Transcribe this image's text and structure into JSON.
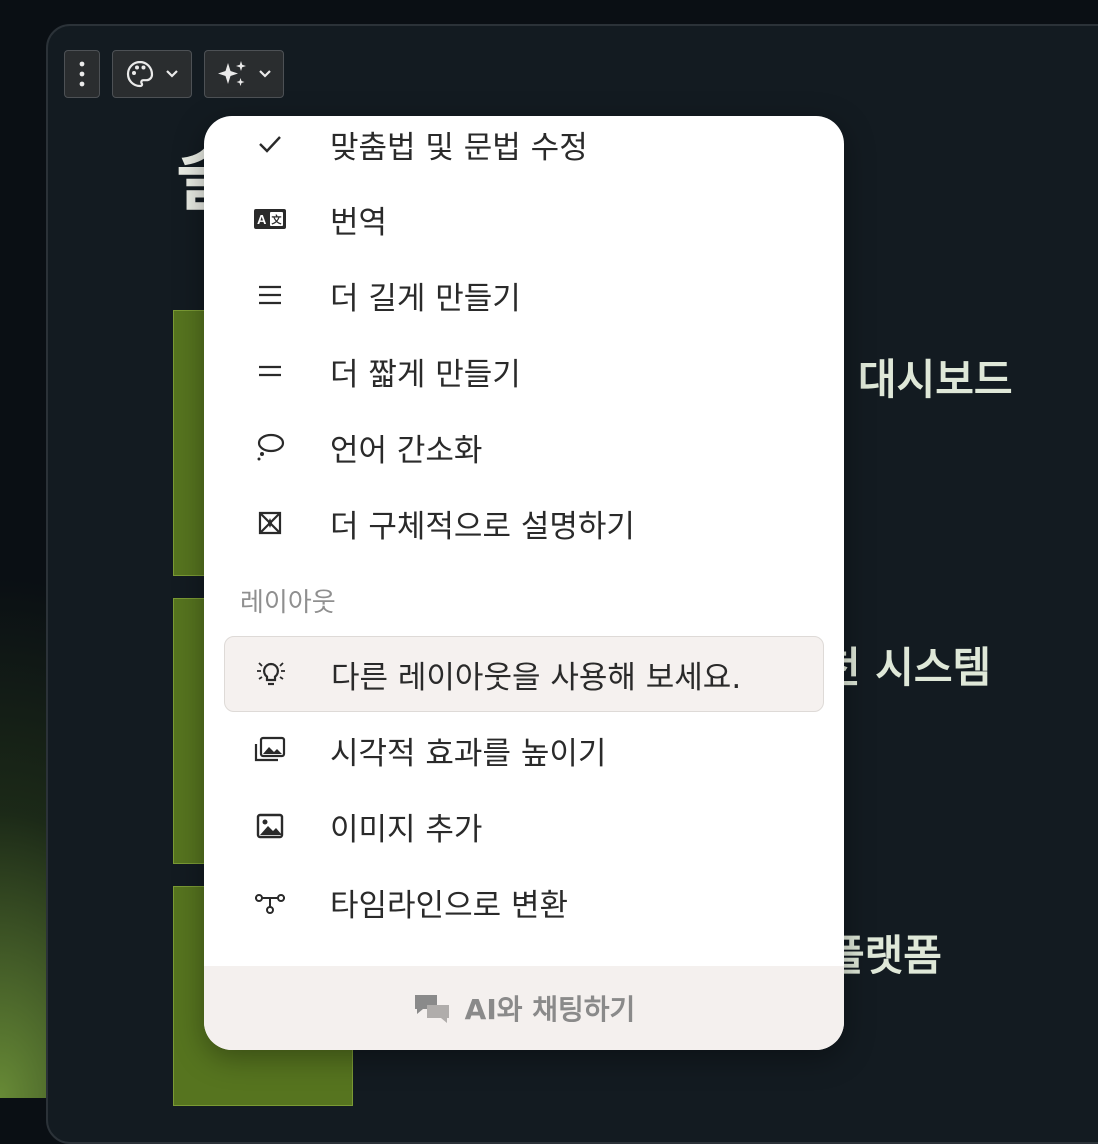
{
  "toolbar": {
    "more_icon": "vertical-dots-icon",
    "theme_icon": "palette-icon",
    "ai_icon": "sparkles-icon"
  },
  "slide": {
    "title": "슬",
    "labels": [
      "대시보드",
      "천 시스템",
      "플랫폼"
    ]
  },
  "menu": {
    "items": [
      {
        "icon": "check-icon",
        "label": "맞춤법 및 문법 수정"
      },
      {
        "icon": "translate-icon",
        "label": "번역"
      },
      {
        "icon": "lines-icon",
        "label": "더 길게 만들기"
      },
      {
        "icon": "equals-icon",
        "label": "더 짧게 만들기"
      },
      {
        "icon": "thought-bubble-icon",
        "label": "언어 간소화"
      },
      {
        "icon": "magic-box-icon",
        "label": "더 구체적으로 설명하기"
      }
    ],
    "section_label": "레이아웃",
    "layout_items": [
      {
        "icon": "lightbulb-icon",
        "label": "다른 레이아웃을 사용해 보세요."
      },
      {
        "icon": "images-icon",
        "label": "시각적 효과를 높이기"
      },
      {
        "icon": "image-icon",
        "label": "이미지 추가"
      },
      {
        "icon": "timeline-icon",
        "label": "타임라인으로 변환"
      }
    ],
    "footer_label": "AI와 채팅하기",
    "footer_icon": "chat-bubbles-icon"
  }
}
